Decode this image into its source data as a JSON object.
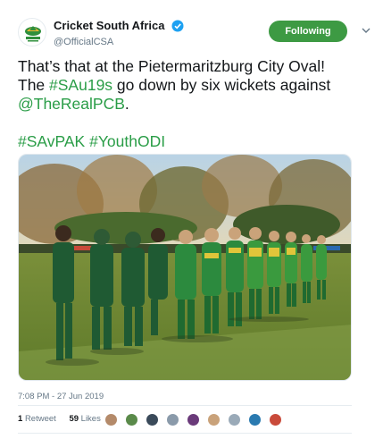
{
  "account": {
    "display_name": "Cricket South Africa",
    "handle": "@OfficialCSA",
    "verified_icon": "verified-badge-icon",
    "logo_icon": "csa-protea-logo-icon"
  },
  "follow_button": {
    "label": "Following"
  },
  "menu_icon": "chevron-down-icon",
  "tweet": {
    "line1_a": "That’s that at the Pietermaritzburg City Oval!",
    "line2_a": "The ",
    "line2_hashtag": "#SAu19s",
    "line2_b": " go down by six wickets against",
    "line3_mention": "@TheRealPCB",
    "line3_b": ".",
    "hashtags_1": "#SAvPAK",
    "hashtags_sep": " ",
    "hashtags_2": "#YouthODI"
  },
  "photo": {
    "subject": "cricket-players-handshake-photo"
  },
  "timestamp": "7:08 PM - 27 Jun 2019",
  "stats": {
    "retweets_count": "1",
    "retweets_label": "Retweet",
    "likes_count": "59",
    "likes_label": "Likes"
  },
  "colors": {
    "follow": "#3d9a43",
    "link": "#2a9d47",
    "muted": "#657786"
  }
}
